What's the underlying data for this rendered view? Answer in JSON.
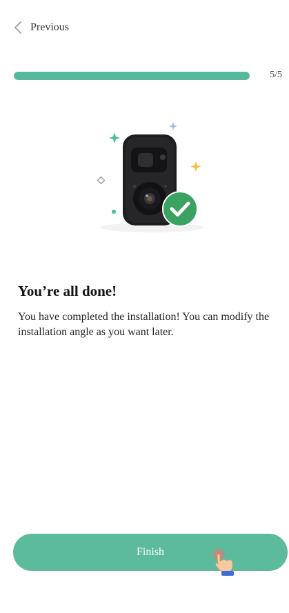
{
  "header": {
    "back_label": "Previous"
  },
  "progress": {
    "current": 5,
    "total": 5,
    "label": "5/5",
    "fraction": 1.0
  },
  "illustration": {
    "icons": [
      "camera-icon",
      "checkmark-badge-icon",
      "sparkle-icon"
    ]
  },
  "content": {
    "title": "You’re all done!",
    "description": "You have completed the installation! You can modify the installation angle as you want later."
  },
  "footer": {
    "finish_label": "Finish"
  },
  "colors": {
    "accent": "#58b89d",
    "button": "#5bbb9c",
    "check_badge": "#3aa361",
    "camera_body": "#1e1e20",
    "sparkle_yellow": "#f0c24a",
    "sparkle_green": "#4fbf8f"
  }
}
